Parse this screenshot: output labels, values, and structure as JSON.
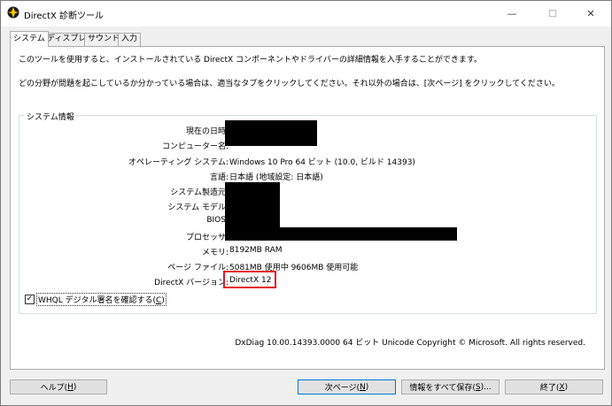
{
  "window": {
    "title": "DirectX 診断ツール",
    "minimize": "—",
    "maximize": "☐",
    "close": "✕"
  },
  "tabs": [
    "システム",
    "ディスプレイ",
    "サウンド",
    "入力"
  ],
  "intro": {
    "line1": "このツールを使用すると、インストールされている DirectX コンポーネントやドライバーの詳細情報を入手することができます。",
    "line2": "どの分野が問題を起こしているか分かっている場合は、適当なタブをクリックしてください。それ以外の場合は、[次ページ] をクリックしてください。"
  },
  "system_info": {
    "group_label": "システム情報",
    "rows": [
      {
        "label": "現在の日時:",
        "value": ""
      },
      {
        "label": "コンピューター名:",
        "value": ""
      },
      {
        "label": "オペレーティング システム:",
        "value": "Windows 10 Pro 64 ビット (10.0, ビルド 14393)"
      },
      {
        "label": "言語:",
        "value": "日本語 (地域設定: 日本語)"
      },
      {
        "label": "システム製造元:",
        "value": ""
      },
      {
        "label": "システム モデル:",
        "value": ""
      },
      {
        "label": "BIOS:",
        "value": ""
      },
      {
        "label": "プロセッサ:",
        "value": ""
      },
      {
        "label": "メモリ:",
        "value": "8192MB RAM"
      },
      {
        "label": "ページ ファイル:",
        "value": "5081MB 使用中 9606MB 使用可能"
      },
      {
        "label": "DirectX バージョン:",
        "value": "DirectX 12"
      }
    ]
  },
  "whql": {
    "checked_glyph": "✓",
    "label_pre": "WHQL デジタル署名を確認する(",
    "label_key": "C",
    "label_post": ")"
  },
  "footer": "DxDiag 10.00.14393.0000 64 ビット Unicode  Copyright © Microsoft. All rights reserved.",
  "buttons": {
    "help": {
      "pre": "ヘルプ(",
      "key": "H",
      "post": ")"
    },
    "next": {
      "pre": "次ページ(",
      "key": "N",
      "post": ")"
    },
    "save": {
      "pre": "情報をすべて保存(",
      "key": "S",
      "post": ")..."
    },
    "exit": {
      "pre": "終了(",
      "key": "X",
      "post": ")"
    }
  },
  "colors": {
    "highlight_box": "#e01b24",
    "redaction": "#000000",
    "default_button_border": "#0078d7"
  }
}
